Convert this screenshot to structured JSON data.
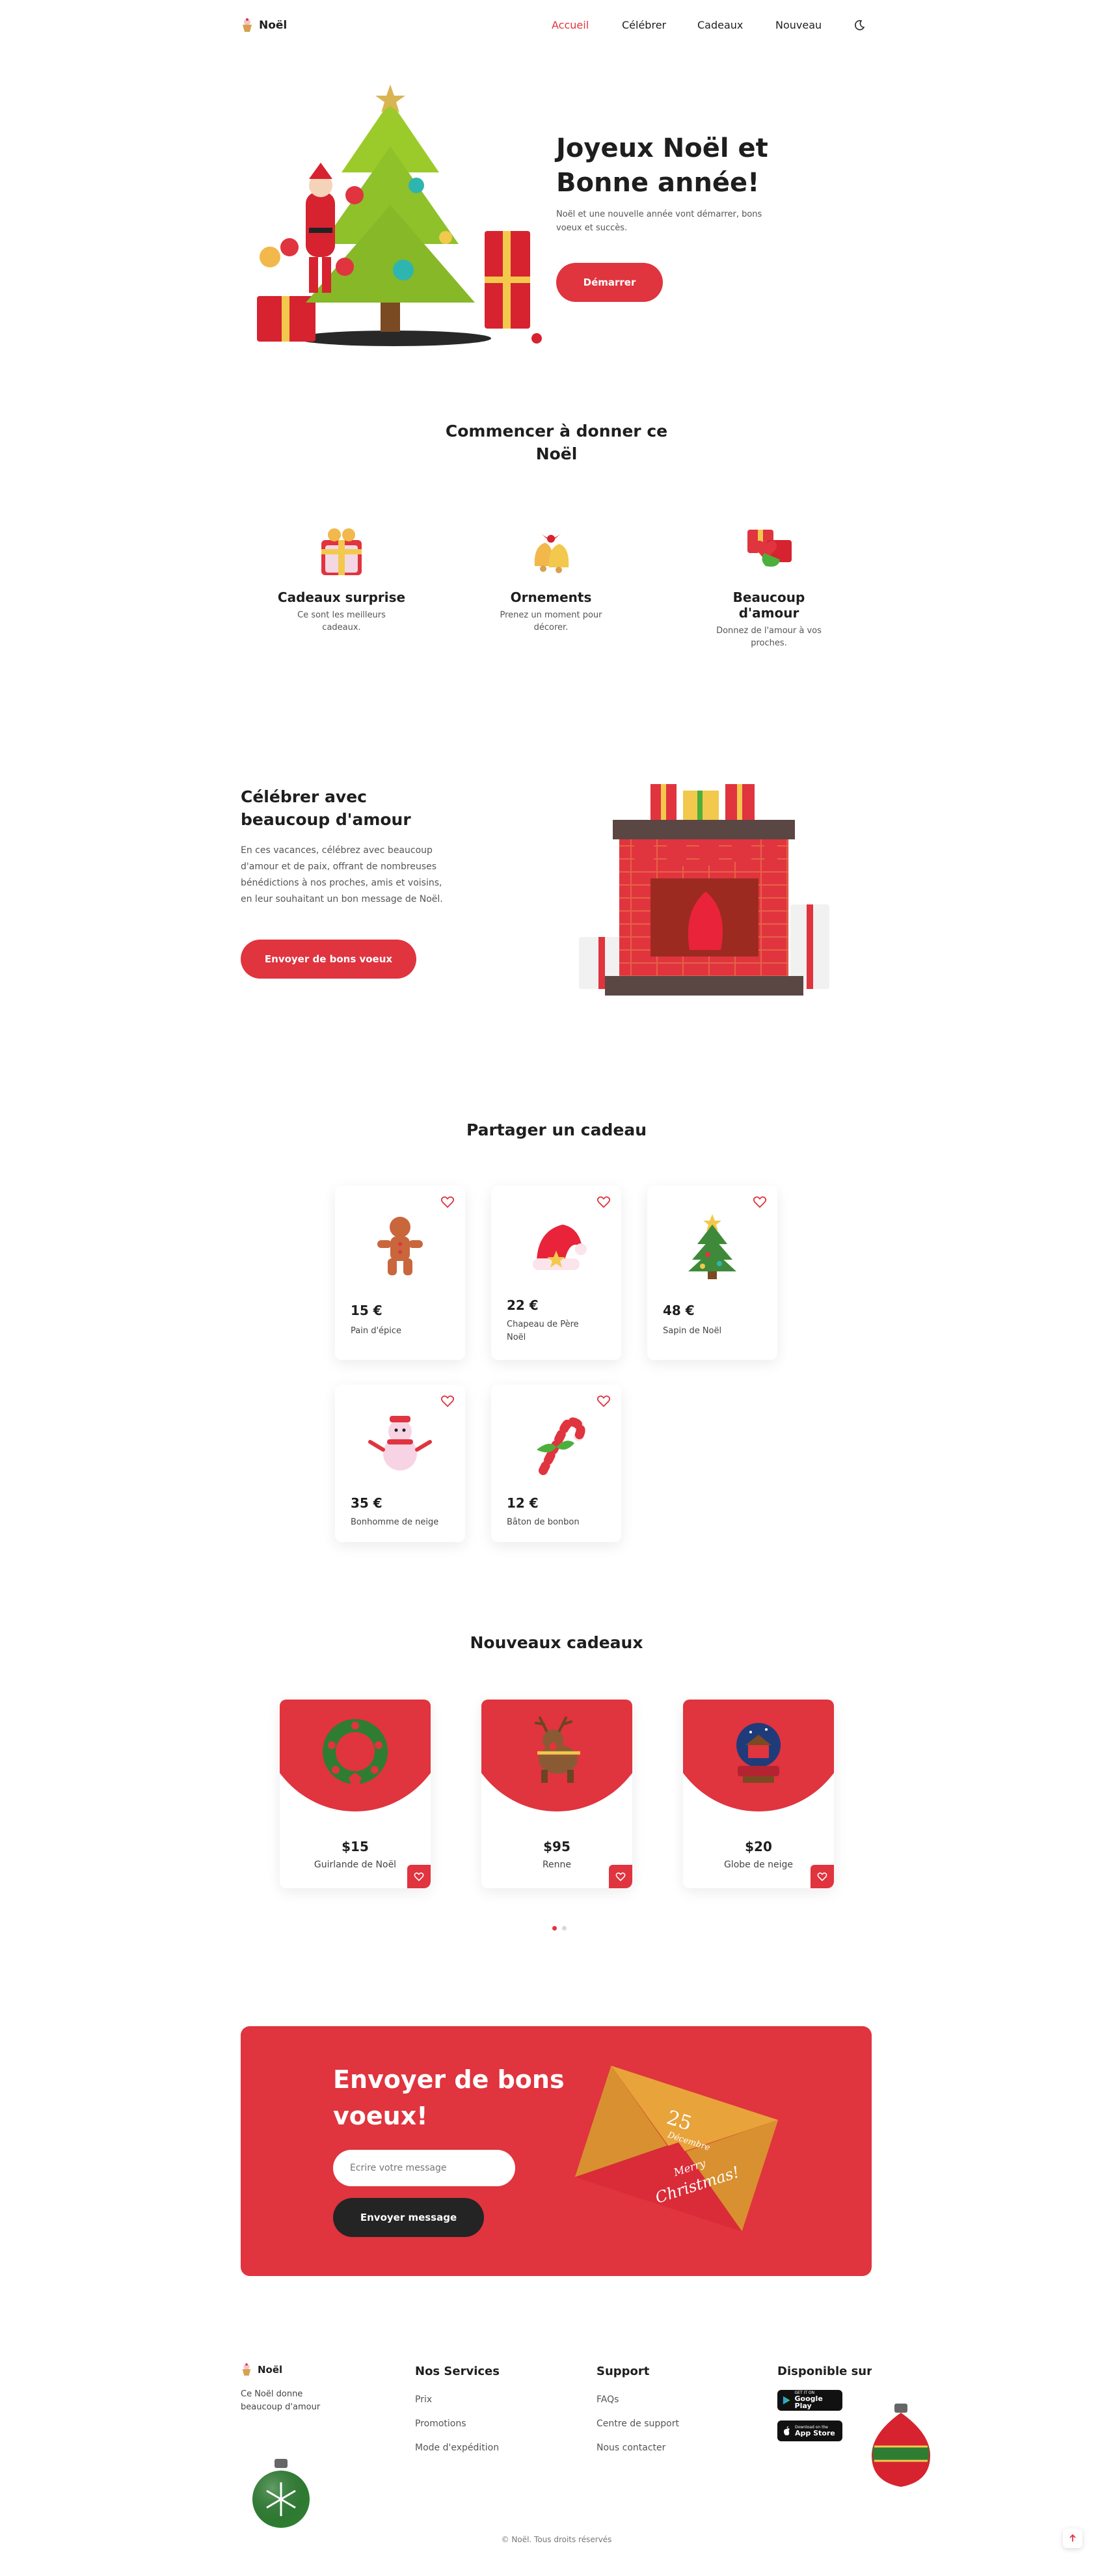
{
  "header": {
    "logo": "Noël",
    "nav": [
      "Accueil",
      "Célébrer",
      "Cadeaux",
      "Nouveau"
    ],
    "active": "Accueil",
    "theme_icon": "moon-icon"
  },
  "hero": {
    "title_line1": "Joyeux Noël et",
    "title_line2": "Bonne année!",
    "subtitle_line1": "Noël et une nouvelle année vont démarrer, bons",
    "subtitle_line2": "voeux et succès.",
    "button": "Démarrer"
  },
  "start": {
    "title_line1": "Commencer à donner ce",
    "title_line2": "Noël",
    "items": [
      {
        "title": "Cadeaux surprise",
        "line1": "Ce sont les meilleurs",
        "line2": "cadeaux.",
        "icon": "gift-box-icon"
      },
      {
        "title": "Ornements",
        "line1": "Prenez un moment pour",
        "line2": "décorer.",
        "icon": "bells-icon"
      },
      {
        "title": "Beaucoup d'amour",
        "line1": "Donnez de l'amour à vos",
        "line2": "proches.",
        "icon": "heart-gift-icon"
      }
    ]
  },
  "celebrate": {
    "title_line1": "Célébrer avec",
    "title_line2": "beaucoup d'amour",
    "text_lines": [
      "En ces vacances, célébrez avec beaucoup",
      "d'amour et de paix, offrant de nombreuses",
      "bénédictions à nos proches, amis et voisins,",
      "en leur souhaitant un bon message de Noël."
    ],
    "button": "Envoyer de bons voeux"
  },
  "share": {
    "title": "Partager un cadeau",
    "cards": [
      {
        "price": "15 €",
        "name_line1": "Pain d'épice",
        "name_line2": "",
        "icon": "gingerbread-icon"
      },
      {
        "price": "22 €",
        "name_line1": "Chapeau de Père",
        "name_line2": "Noël",
        "icon": "santa-hat-icon"
      },
      {
        "price": "48 €",
        "name_line1": "Sapin de Noël",
        "name_line2": "",
        "icon": "christmas-tree-icon"
      },
      {
        "price": "35 €",
        "name_line1": "Bonhomme de neige",
        "name_line2": "",
        "icon": "snowman-icon"
      },
      {
        "price": "12 €",
        "name_line1": "Bâton de bonbon",
        "name_line2": "",
        "icon": "candy-cane-icon"
      }
    ]
  },
  "new_gifts": {
    "title": "Nouveaux cadeaux",
    "cards": [
      {
        "price": "$15",
        "name": "Guirlande de Noël",
        "icon": "wreath-icon"
      },
      {
        "price": "$95",
        "name": "Renne",
        "icon": "reindeer-icon"
      },
      {
        "price": "$20",
        "name": "Globe de neige",
        "icon": "snow-globe-icon"
      }
    ],
    "pagination_active": 1,
    "pagination_total": 2
  },
  "wishes": {
    "title_line1": "Envoyer de bons",
    "title_line2": "voeux!",
    "placeholder": "Écrire votre message",
    "button": "Envoyer message",
    "envelope_number": "25",
    "envelope_month": "Décembre",
    "envelope_line1": "Merry",
    "envelope_line2": "Christmas!"
  },
  "footer": {
    "logo": "Noël",
    "tagline_line1": "Ce Noël donne",
    "tagline_line2": "beaucoup d'amour",
    "services_title": "Nos Services",
    "services": [
      "Prix",
      "Promotions",
      "Mode d'expédition"
    ],
    "support_title": "Support",
    "support": [
      "FAQs",
      "Centre de support",
      "Nous contacter"
    ],
    "available_title": "Disponible sur",
    "google_small": "GET IT ON",
    "google_big": "Google Play",
    "apple_small": "Download on the",
    "apple_big": "App Store",
    "copyright": "© Noël. Tous droits réservés"
  },
  "colors": {
    "accent": "#e0343f",
    "dark": "#1e1e1e"
  }
}
